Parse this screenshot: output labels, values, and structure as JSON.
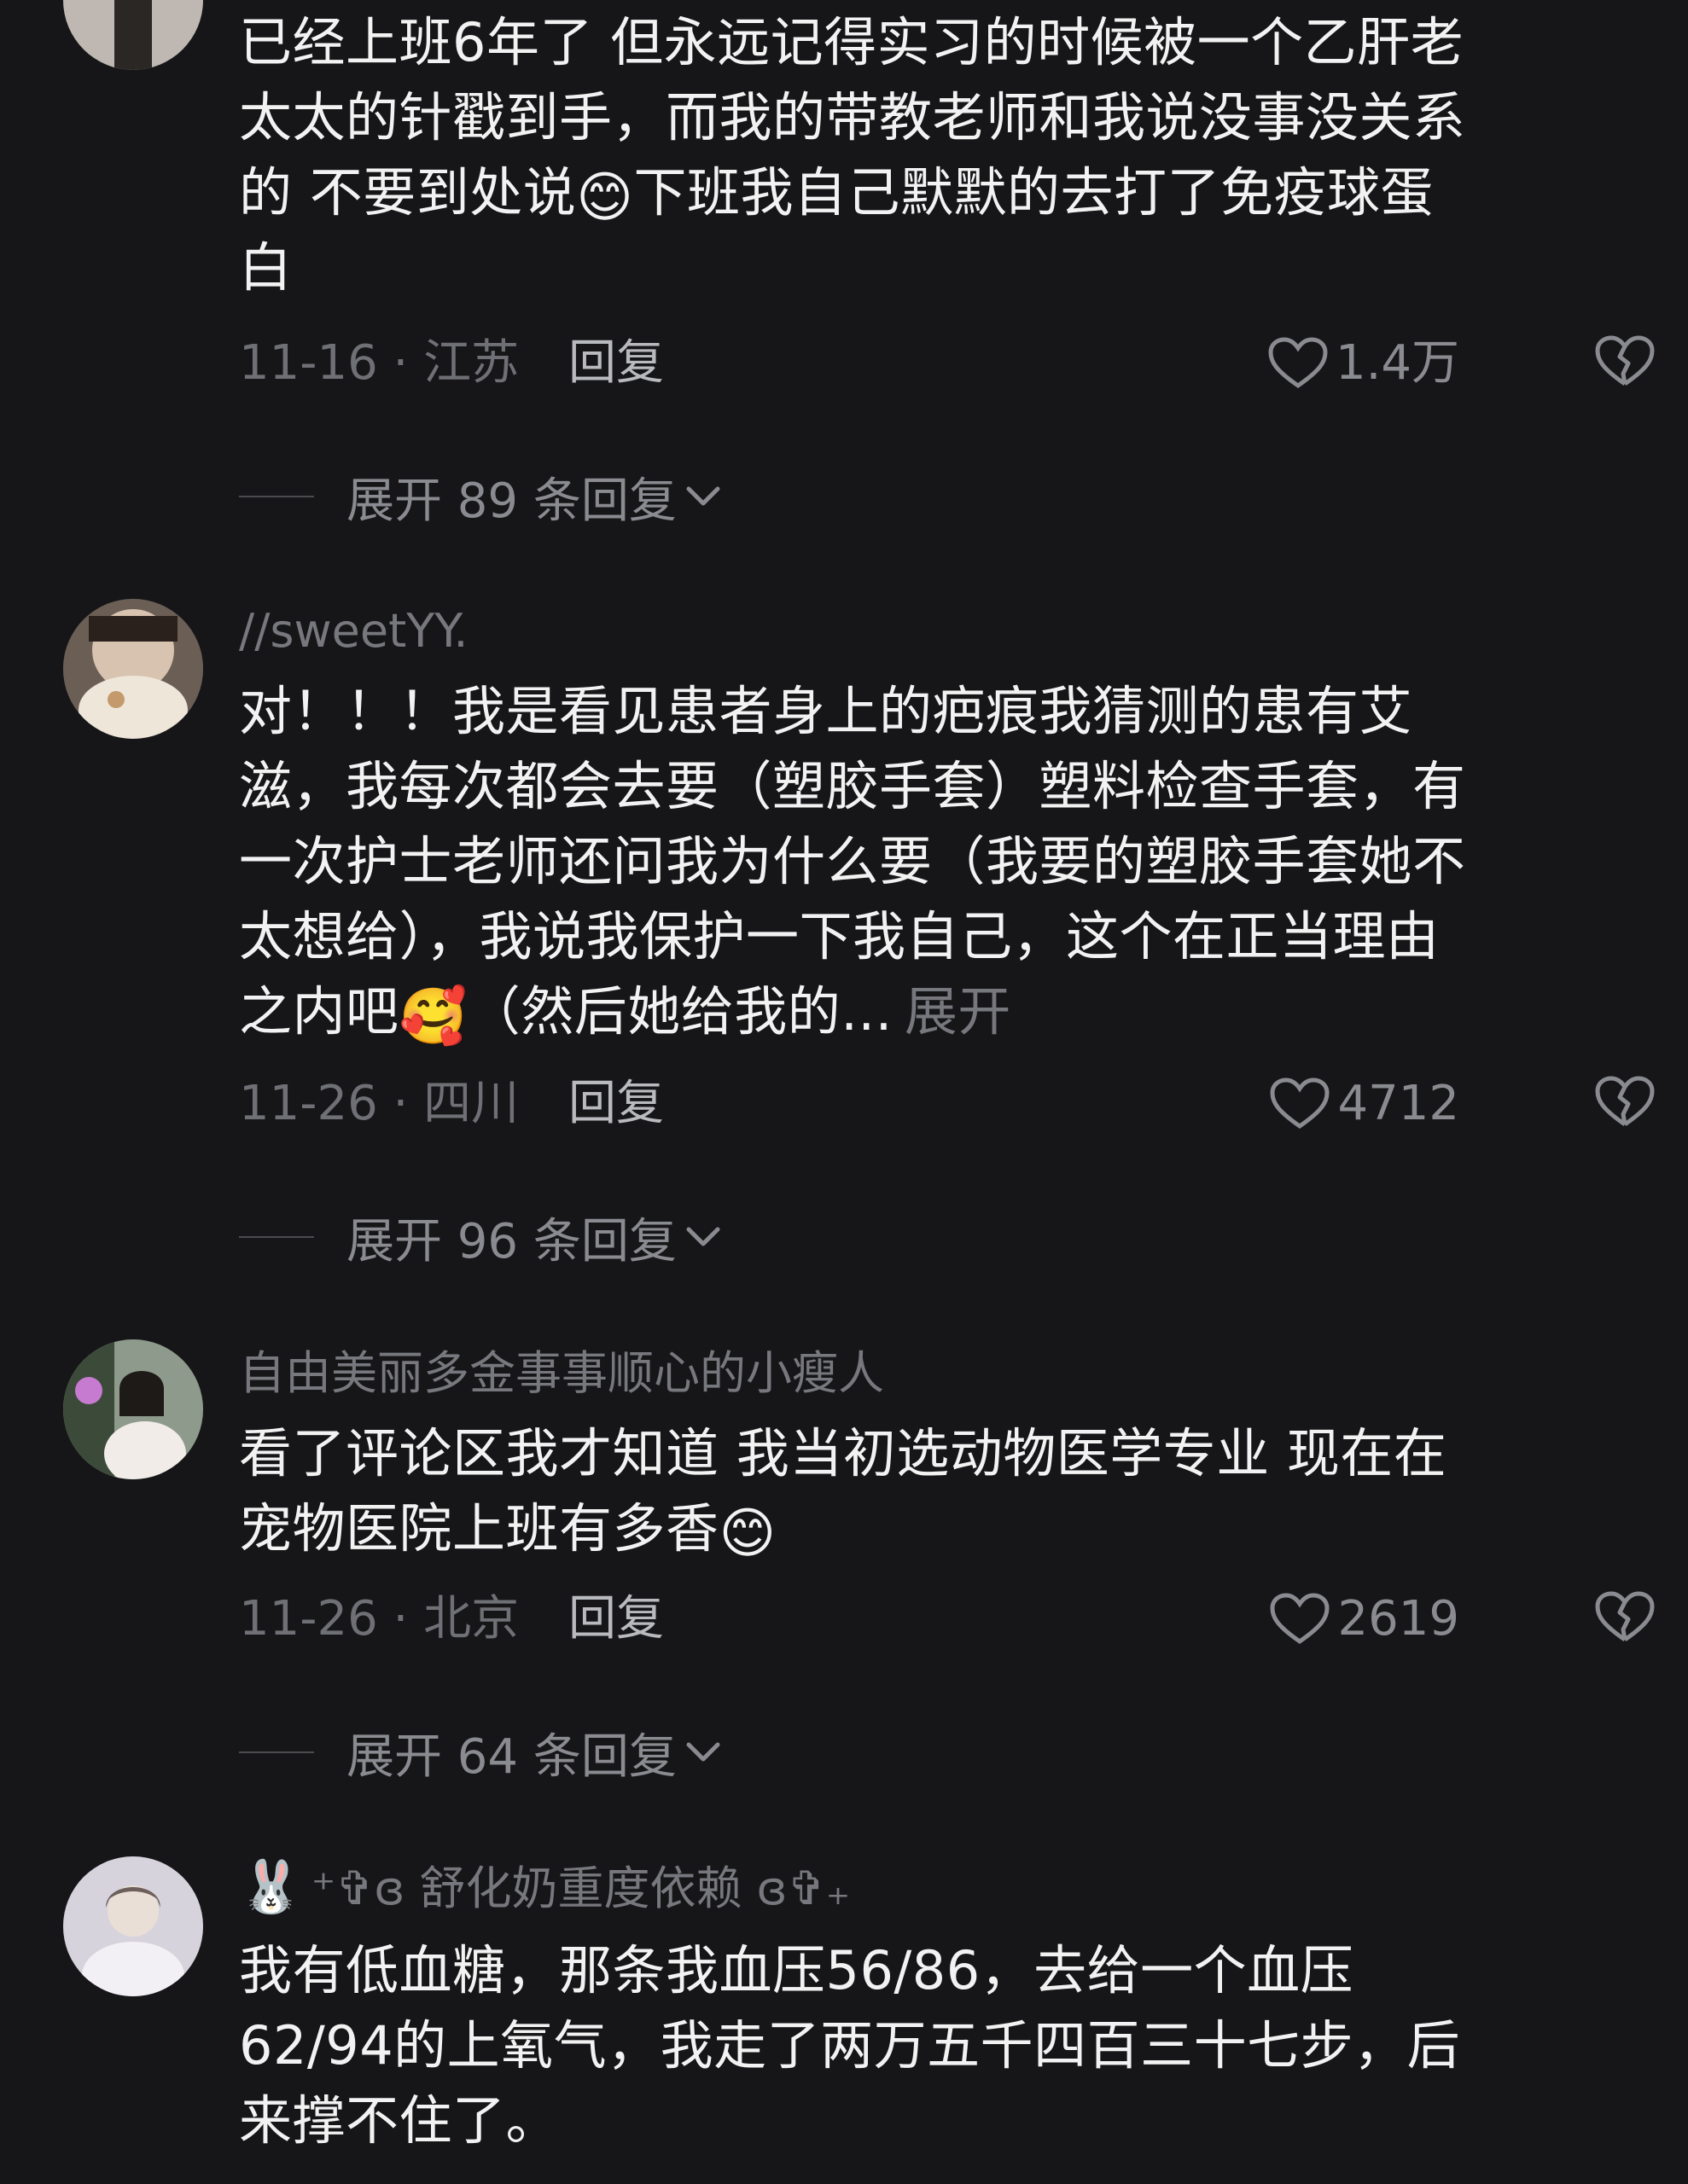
{
  "comments": [
    {
      "username": "",
      "lines": [
        "已经上班6年了 但永远记得实习的时候被一个乙肝老",
        "太太的针戳到手，而我的带教老师和我说没事没关系",
        "的 不要到处说",
        "下班我自己默默的去打了免疫球蛋",
        "白"
      ],
      "date_location": "11-16 · 江苏",
      "reply_label": "回复",
      "likes": "1.4万",
      "expand_label": "展开 89 条回复"
    },
    {
      "username": "//sweetYY.",
      "lines": [
        "对！！！我是看见患者身上的疤痕我猜测的患有艾",
        "滋，我每次都会去要（塑胶手套）塑料检查手套，有",
        "一次护士老师还问我为什么要（我要的塑胶手套她不",
        "太想给），我说我保护一下我自己，这个在正当理由",
        "之内吧",
        "（然后她给我的...",
        "展开"
      ],
      "date_location": "11-26 · 四川",
      "reply_label": "回复",
      "likes": "4712",
      "expand_label": "展开 96 条回复"
    },
    {
      "username": "自由美丽多金事事顺心的小瘦人",
      "lines": [
        "看了评论区我才知道 我当初选动物医学专业 现在在",
        "宠物医院上班有多香"
      ],
      "date_location": "11-26 · 北京",
      "reply_label": "回复",
      "likes": "2619",
      "expand_label": "展开 64 条回复"
    },
    {
      "username_prefix": "🐰",
      "username": "⁺✞ɞ 舒化奶重度依赖 ɞ✞₊",
      "lines": [
        "我有低血糖，那条我血压56/86，去给一个血压",
        "62/94的上氧气，我走了两万五千四百三十七步，后",
        "来撑不住了。"
      ]
    }
  ],
  "emoji": {
    "smile": "😊",
    "blush": "🥰"
  },
  "colors": {
    "background": "#161618",
    "text": "#f2f2f2",
    "muted": "#77787d",
    "reply": "#b9babe"
  },
  "icons": [
    "heart-icon",
    "broken-heart-icon",
    "chevron-down-icon"
  ]
}
